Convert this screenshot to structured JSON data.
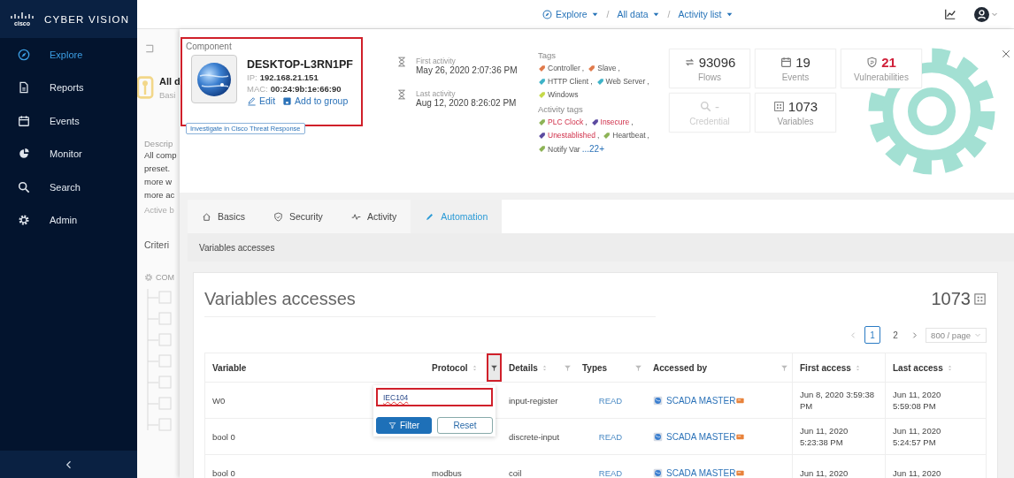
{
  "sidebar": {
    "logo_text": "cisco",
    "brand": "CYBER VISION",
    "items": [
      {
        "label": "Explore",
        "selected": true
      },
      {
        "label": "Reports",
        "selected": false
      },
      {
        "label": "Events",
        "selected": false
      },
      {
        "label": "Monitor",
        "selected": false
      },
      {
        "label": "Search",
        "selected": false
      },
      {
        "label": "Admin",
        "selected": false
      }
    ]
  },
  "topbar": {
    "breadcrumbs": [
      "Explore",
      "All data",
      "Activity list"
    ],
    "separator": "/"
  },
  "background_panel": {
    "title": "All d",
    "subtitle": "Basi",
    "description_label": "Descrip",
    "description": [
      "All comp",
      "preset.",
      "more w",
      "more ac"
    ],
    "active": "Active b",
    "criteria": "Criteri",
    "tree_root": "COM"
  },
  "component": {
    "heading": "Component",
    "highlighted": true,
    "name": "DESKTOP-L3RN1PF",
    "ip_label": "IP:",
    "ip": "192.168.21.151",
    "mac_label": "MAC:",
    "mac": "00:24:9b:1e:66:90",
    "actions": [
      "Edit",
      "Add to group"
    ],
    "investigate": "Investigate in Cisco Threat Response"
  },
  "activity": [
    {
      "label": "First activity",
      "value": "May 26, 2020 2:07:36 PM"
    },
    {
      "label": "Last activity",
      "value": "Aug 12, 2020 8:26:02 PM"
    }
  ],
  "tags": {
    "title": "Tags",
    "separator": ",",
    "items": [
      {
        "label": "Controller",
        "color": "#e07a4b",
        "alert": false
      },
      {
        "label": "Slave",
        "color": "#e07a4b",
        "alert": false
      },
      {
        "label": "HTTP Client",
        "color": "#3fb3c8",
        "alert": false
      },
      {
        "label": "Web Server",
        "color": "#3fb3c8",
        "alert": false
      },
      {
        "label": "Windows",
        "color": "#c5d94a",
        "alert": false
      }
    ]
  },
  "activity_tags": {
    "title": "Activity tags",
    "separator": ",",
    "more": "...22+",
    "items": [
      {
        "label": "PLC Clock",
        "color": "#8db356",
        "alert": true
      },
      {
        "label": "Insecure",
        "color": "#5b4aa0",
        "alert": true
      },
      {
        "label": "Unestablished",
        "color": "#5b4aa0",
        "alert": true
      },
      {
        "label": "Heartbeat",
        "color": "#8db356",
        "alert": false
      },
      {
        "label": "Notify Var",
        "color": "#8db356",
        "alert": false
      }
    ]
  },
  "stats": [
    {
      "kind": "flows",
      "value": "93096",
      "label": "Flows",
      "alert": false,
      "disabled": false
    },
    {
      "kind": "events",
      "value": "19",
      "label": "Events",
      "alert": false,
      "disabled": false
    },
    {
      "kind": "vulnerabilities",
      "value": "21",
      "label": "Vulnerabilities",
      "alert": true,
      "disabled": false
    },
    {
      "kind": "credential",
      "value": "-",
      "label": "Credential",
      "alert": false,
      "disabled": true
    },
    {
      "kind": "variables",
      "value": "1073",
      "label": "Variables",
      "alert": false,
      "disabled": false
    }
  ],
  "tabs": [
    {
      "label": "Basics",
      "selected": false
    },
    {
      "label": "Security",
      "selected": false
    },
    {
      "label": "Activity",
      "selected": false
    },
    {
      "label": "Automation",
      "selected": true
    }
  ],
  "section_title": "Variables accesses",
  "card": {
    "title": "Variables accesses",
    "count": "1073",
    "pagination": {
      "pages": [
        {
          "label": "1",
          "selected": true
        },
        {
          "label": "2",
          "selected": false
        }
      ],
      "page_size": "800 / page"
    },
    "columns": [
      {
        "label": "Variable",
        "sortable": false,
        "filterable": false
      },
      {
        "label": "Protocol",
        "sortable": true,
        "filterable": true,
        "filter_highlighted": true
      },
      {
        "label": "Details",
        "sortable": true,
        "filterable": true,
        "filter_highlighted": false
      },
      {
        "label": "Types",
        "sortable": false,
        "filterable": true,
        "filter_highlighted": false
      },
      {
        "label": "Accessed by",
        "sortable": false,
        "filterable": true,
        "filter_highlighted": false
      },
      {
        "label": "First access",
        "sortable": true,
        "filterable": false
      },
      {
        "label": "Last access",
        "sortable": true,
        "filterable": false
      }
    ],
    "rows": [
      {
        "variable": "W0",
        "details": "input-register",
        "type": "READ",
        "accessed_by": "SCADA MASTER",
        "first_access": "Jun 8, 2020 3:59:38 PM",
        "last_access": "Jun 11, 2020 5:59:08 PM"
      },
      {
        "variable": "bool 0",
        "details": "discrete-input",
        "type": "READ",
        "accessed_by": "SCADA MASTER",
        "first_access": "Jun 11, 2020 5:23:38 PM",
        "last_access": "Jun 11, 2020 5:24:57 PM"
      },
      {
        "variable": "bool 0",
        "protocol": "modbus",
        "details": "coil",
        "type": "READ",
        "accessed_by": "SCADA MASTER",
        "first_access": "Jun 11, 2020",
        "last_access": "Jun 11, 2020"
      }
    ],
    "filter_popup": {
      "value": "IEC104",
      "highlighted": true,
      "buttons": [
        {
          "label": "Filter",
          "kind": "primary"
        },
        {
          "label": "Reset",
          "kind": "secondary"
        }
      ]
    }
  }
}
